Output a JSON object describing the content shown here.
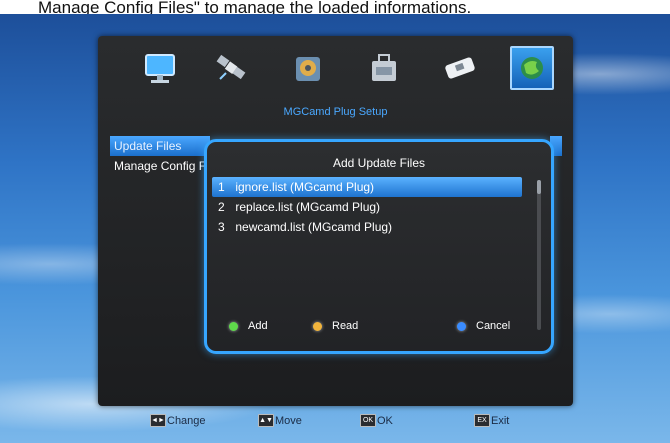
{
  "caption": "Manage Config Files\" to manage the loaded informations.",
  "menu_title": "MGCamd Plug Setup",
  "icons": [
    "monitor-icon",
    "satellite-icon",
    "settings-icon",
    "toolbox-icon",
    "plug-icon",
    "globe-icon"
  ],
  "left_menu": {
    "items": [
      {
        "label": "Update Files"
      },
      {
        "label": "Manage Config Files"
      }
    ]
  },
  "dialog": {
    "title": "Add Update Files",
    "items": [
      {
        "num": "1",
        "label": "ignore.list (MGcamd Plug)"
      },
      {
        "num": "2",
        "label": "replace.list (MGcamd Plug)"
      },
      {
        "num": "3",
        "label": "newcamd.list (MGcamd Plug)"
      }
    ],
    "buttons": {
      "add": {
        "label": "Add",
        "color": "#5fd94b"
      },
      "read": {
        "label": "Read",
        "color": "#f1b43c"
      },
      "cancel": {
        "label": "Cancel",
        "color": "#3a8cff"
      }
    }
  },
  "footer": {
    "change": "Change",
    "move": "Move",
    "ok": "OK",
    "exit": "Exit"
  },
  "colors": {
    "accent": "#36a6ff",
    "selection": "#1e73cf"
  }
}
